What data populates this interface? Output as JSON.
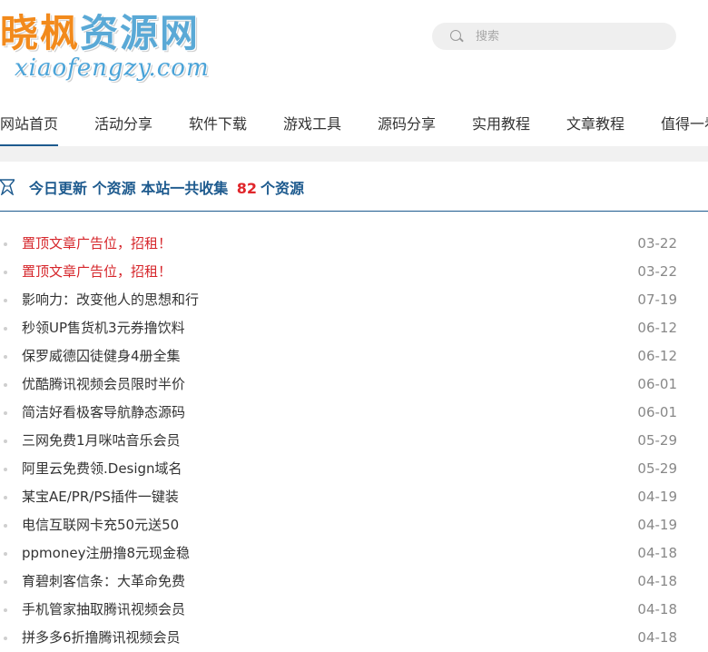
{
  "header": {
    "logo_title_part1": "晓枫",
    "logo_title_part2": "资源网",
    "logo_subtitle": "xiaofengzy.com",
    "search_placeholder": "搜索"
  },
  "nav": {
    "items": [
      {
        "label": "网站首页",
        "active": true
      },
      {
        "label": "活动分享"
      },
      {
        "label": "软件下载"
      },
      {
        "label": "游戏工具"
      },
      {
        "label": "源码分享"
      },
      {
        "label": "实用教程"
      },
      {
        "label": "文章教程"
      },
      {
        "label": "值得一看"
      }
    ]
  },
  "stats": {
    "today_label": "今日更新",
    "today_suffix": "个资源",
    "total_prefix": "本站一共收集",
    "total_count": "82",
    "total_suffix": "个资源"
  },
  "colors": {
    "accent_blue": "#1d5a8e",
    "highlight_red": "#d6262b"
  },
  "articles": [
    {
      "title": "置顶文章广告位，招租！",
      "date": "03-22",
      "pinned": true
    },
    {
      "title": "置顶文章广告位，招租！",
      "date": "03-22",
      "pinned": true
    },
    {
      "title": "影响力：改变他人的思想和行",
      "date": "07-19"
    },
    {
      "title": "秒领UP售货机3元券撸饮料",
      "date": "06-12"
    },
    {
      "title": "保罗威德囚徒健身4册全集",
      "date": "06-12"
    },
    {
      "title": "优酷腾讯视频会员限时半价",
      "date": "06-01"
    },
    {
      "title": "简洁好看极客导航静态源码",
      "date": "06-01"
    },
    {
      "title": "三网免费1月咪咕音乐会员",
      "date": "05-29"
    },
    {
      "title": "阿里云免费领.Design域名",
      "date": "05-29"
    },
    {
      "title": "某宝AE/PR/PS插件一键装",
      "date": "04-19"
    },
    {
      "title": "电信互联网卡充50元送50",
      "date": "04-19"
    },
    {
      "title": "ppmoney注册撸8元现金稳",
      "date": "04-18"
    },
    {
      "title": "育碧刺客信条：大革命免费",
      "date": "04-18"
    },
    {
      "title": "手机管家抽取腾讯视频会员",
      "date": "04-18"
    },
    {
      "title": "拼多多6折撸腾讯视频会员",
      "date": "04-18"
    }
  ]
}
